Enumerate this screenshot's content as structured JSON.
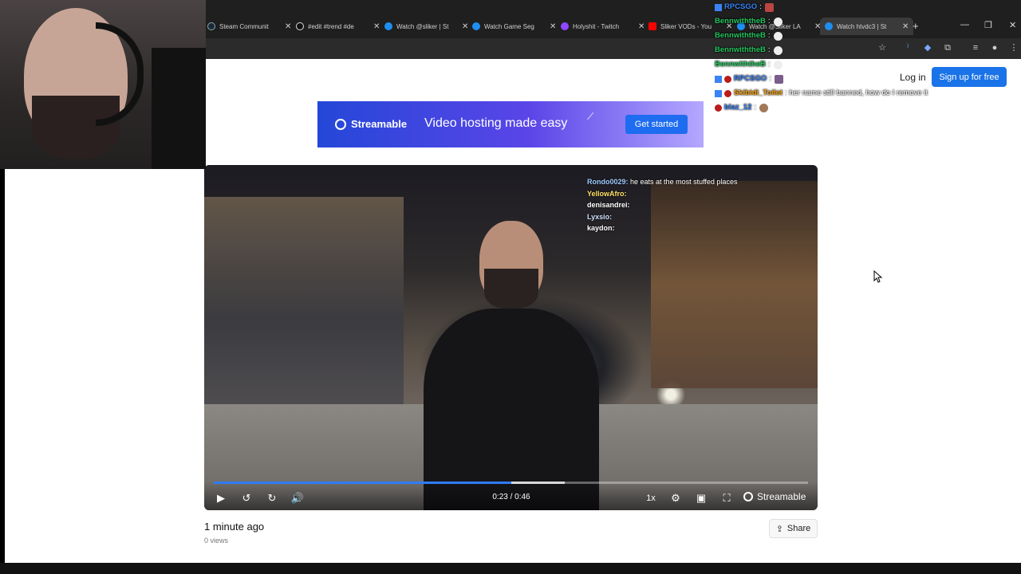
{
  "browser": {
    "tabs": [
      {
        "title": "Steam Communit",
        "color": "#1b2838"
      },
      {
        "title": "#edit #trend #de",
        "color": "#ffffff"
      },
      {
        "title": "Watch @sliker | St",
        "color": "#1f8ef1"
      },
      {
        "title": "Watch Game Seg",
        "color": "#1f8ef1"
      },
      {
        "title": "Holyshit - Twitch",
        "color": "#9146ff"
      },
      {
        "title": "Sliker VODs - You",
        "color": "#ff0000"
      },
      {
        "title": "Watch @Sliker LA",
        "color": "#1f8ef1"
      },
      {
        "title": "Watch htvdc3 | St",
        "color": "#1f8ef1"
      }
    ],
    "active_tab_index": 7
  },
  "header": {
    "login_label": "Log in",
    "signup_label": "Sign up for free"
  },
  "banner": {
    "brand": "Streamable",
    "tagline": "Video hosting made easy",
    "cta_label": "Get started"
  },
  "video": {
    "current_time": "0:23",
    "duration": "0:46",
    "time_display": "0:23 / 0:46",
    "progress_fraction": 0.5,
    "buffered_fraction": 0.59,
    "speed_label": "1x",
    "brand_label": "Streamable",
    "overlay_chat": [
      {
        "name": "Rondo0029:",
        "text": "he eats at the most stuffed places",
        "color": "#9ecbff"
      },
      {
        "name": "YellowAfro:",
        "text": "",
        "color": "#ffe066"
      },
      {
        "name": "denisandrei:",
        "text": "",
        "color": "#ffffff"
      },
      {
        "name": "Lyxsio:",
        "text": "",
        "color": "#cfe3ff"
      },
      {
        "name": "kaydon:",
        "text": "",
        "color": "#ffffff"
      }
    ]
  },
  "meta": {
    "posted": "1 minute ago",
    "views": "0 views",
    "share_label": "Share"
  },
  "stream_chat": [
    {
      "name": "RPCSGO",
      "text": ":",
      "color": "#3b82f6"
    },
    {
      "name": "BennwiththeB",
      "text": ":",
      "color": "#22c55e"
    },
    {
      "name": "BennwiththeB",
      "text": ":",
      "color": "#22c55e"
    },
    {
      "name": "BennwiththeB",
      "text": ":",
      "color": "#22c55e"
    },
    {
      "name": "BennwiththeB",
      "text": ":",
      "color": "#22c55e"
    },
    {
      "name": "RPCSGO",
      "text": ":",
      "color": "#3b82f6"
    },
    {
      "name": "Skibidi_Toilet",
      "text": ": her name still banned, how do I remove it",
      "color": "#f59e0b"
    },
    {
      "name": "blaz_12",
      "text": ":",
      "color": "#3b82f6"
    }
  ]
}
